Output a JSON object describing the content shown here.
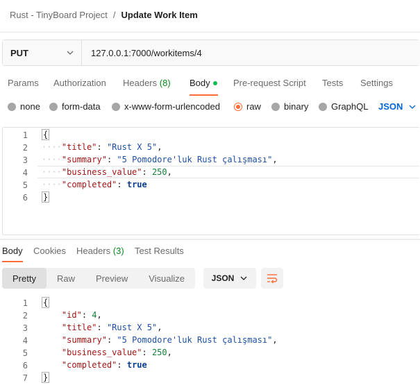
{
  "breadcrumb": {
    "parent": "Rust - TinyBoard Project",
    "separator": "/",
    "current": "Update Work Item"
  },
  "request": {
    "method": "PUT",
    "url": "127.0.0.1:7000/workitems/4"
  },
  "request_tabs": {
    "params": "Params",
    "authorization": "Authorization",
    "headers": "Headers",
    "headers_count": "(8)",
    "body": "Body",
    "pre_request": "Pre-request Script",
    "tests": "Tests",
    "settings": "Settings"
  },
  "body_modes": {
    "none": "none",
    "form_data": "form-data",
    "urlencoded": "x-www-form-urlencoded",
    "raw": "raw",
    "binary": "binary",
    "graphql": "GraphQL",
    "raw_type": "JSON"
  },
  "request_body": {
    "line_numbers": [
      "1",
      "2",
      "3",
      "4",
      "5",
      "6"
    ],
    "open": "{",
    "close": "}",
    "title_key": "\"title\"",
    "title_val": "\"Rust X 5\"",
    "summary_key": "\"summary\"",
    "summary_val": "\"5 Pomodore'luk Rust çalışması\"",
    "bv_key": "\"business_value\"",
    "bv_val": "250",
    "completed_key": "\"completed\"",
    "completed_val": "true"
  },
  "response_tabs": {
    "body": "Body",
    "cookies": "Cookies",
    "headers": "Headers",
    "headers_count": "(3)",
    "test_results": "Test Results"
  },
  "view_modes": {
    "pretty": "Pretty",
    "raw": "Raw",
    "preview": "Preview",
    "visualize": "Visualize",
    "format": "JSON"
  },
  "response_body": {
    "line_numbers": [
      "1",
      "2",
      "3",
      "4",
      "5",
      "6",
      "7"
    ],
    "open": "{",
    "close": "}",
    "id_key": "\"id\"",
    "id_val": "4",
    "title_key": "\"title\"",
    "title_val": "\"Rust X 5\"",
    "summary_key": "\"summary\"",
    "summary_val": "\"5 Pomodore'luk Rust çalışması\"",
    "bv_key": "\"business_value\"",
    "bv_val": "250",
    "completed_key": "\"completed\"",
    "completed_val": "true"
  },
  "colors": {
    "accent": "#ff6c37",
    "link_blue": "#0265d2",
    "count_green": "#0a8a1f",
    "active_dot": "#0cbb52"
  }
}
